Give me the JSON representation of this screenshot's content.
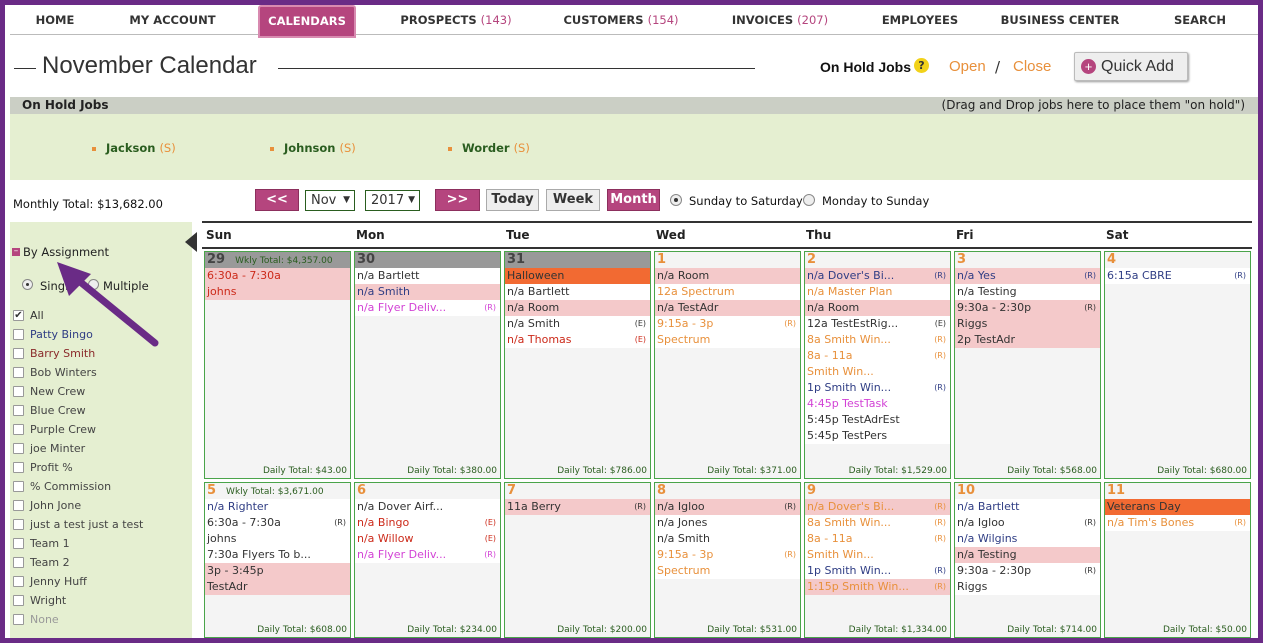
{
  "nav": {
    "items": [
      {
        "label": "HOME",
        "count": ""
      },
      {
        "label": "MY ACCOUNT",
        "count": ""
      },
      {
        "label": "CALENDARS",
        "count": ""
      },
      {
        "label": "PROSPECTS",
        "count": "(143)"
      },
      {
        "label": "CUSTOMERS",
        "count": "(154)"
      },
      {
        "label": "INVOICES",
        "count": "(207)"
      },
      {
        "label": "EMPLOYEES",
        "count": ""
      },
      {
        "label": "BUSINESS CENTER",
        "count": ""
      },
      {
        "label": "SEARCH",
        "count": ""
      }
    ],
    "active": "CALENDARS"
  },
  "header": {
    "title": "November Calendar",
    "on_hold_label": "On Hold Jobs",
    "help_icon": "?",
    "open_link": "Open",
    "separator": "/",
    "close_link": "Close",
    "quick_add": "Quick Add",
    "quick_add_icon": "+"
  },
  "on_hold": {
    "bar_label": "On Hold Jobs",
    "hint": "(Drag and Drop jobs here to place them \"on hold\")",
    "jobs": [
      {
        "name": "Jackson",
        "badge": "(S)"
      },
      {
        "name": "Johnson",
        "badge": "(S)"
      },
      {
        "name": "Worder",
        "badge": "(S)"
      }
    ]
  },
  "controls": {
    "monthly_total": "Monthly Total: $13,682.00",
    "prev": "<<",
    "month_value": "Nov",
    "year_value": "2017",
    "next": ">>",
    "today": "Today",
    "week": "Week",
    "month": "Month",
    "radio_sun": "Sunday to Saturday",
    "radio_mon": "Monday to Sunday",
    "radio_selected": "Sunday to Saturday",
    "select_arrow": "▼"
  },
  "sidebar": {
    "collapse_icon": "–",
    "title": "By Assignment",
    "mode_single": "Single",
    "mode_multiple": "Multiple",
    "mode_selected": "Single",
    "items": [
      {
        "label": "All",
        "checked": true,
        "color": "#333333"
      },
      {
        "label": "Patty Bingo",
        "checked": false,
        "color": "#2f3d84"
      },
      {
        "label": "Barry Smith",
        "checked": false,
        "color": "#8a2a2a"
      },
      {
        "label": "Bob Winters",
        "checked": false,
        "color": "#444444"
      },
      {
        "label": "New Crew",
        "checked": false,
        "color": "#444444"
      },
      {
        "label": "Blue Crew",
        "checked": false,
        "color": "#444444"
      },
      {
        "label": "Purple Crew",
        "checked": false,
        "color": "#444444"
      },
      {
        "label": "joe Minter",
        "checked": false,
        "color": "#444444"
      },
      {
        "label": "Profit %",
        "checked": false,
        "color": "#444444"
      },
      {
        "label": "% Commission",
        "checked": false,
        "color": "#444444"
      },
      {
        "label": "John Jone",
        "checked": false,
        "color": "#444444"
      },
      {
        "label": "just a test just a test",
        "checked": false,
        "color": "#444444"
      },
      {
        "label": "Team 1",
        "checked": false,
        "color": "#444444"
      },
      {
        "label": "Team 2",
        "checked": false,
        "color": "#444444"
      },
      {
        "label": "Jenny Huff",
        "checked": false,
        "color": "#444444"
      },
      {
        "label": "Wright",
        "checked": false,
        "color": "#444444"
      },
      {
        "label": "None",
        "checked": false,
        "color": "#999999"
      }
    ],
    "check_mark": "✔"
  },
  "calendar": {
    "days": [
      "Sun",
      "Mon",
      "Tue",
      "Wed",
      "Thu",
      "Fri",
      "Sat"
    ],
    "weeks": [
      {
        "weekly_total": "Wkly Total: $4,357.00",
        "cells": [
          {
            "date": "29",
            "prev": true,
            "total": "Daily Total: $43.00",
            "events": [
              {
                "text": "6:30a - 7:30a",
                "color": "c-red",
                "bg": "pink",
                "tag": ""
              },
              {
                "text": "johns",
                "color": "c-red",
                "bg": "pink",
                "tag": ""
              }
            ]
          },
          {
            "date": "30",
            "prev": true,
            "total": "Daily Total: $380.00",
            "events": [
              {
                "text": "n/a Bartlett",
                "color": "c-dark",
                "bg": "white",
                "tag": ""
              },
              {
                "text": "n/a Smith",
                "color": "c-navy",
                "bg": "pink",
                "tag": ""
              },
              {
                "text": "n/a Flyer Deliv...",
                "color": "c-purple",
                "bg": "white",
                "tag": "(R)"
              }
            ]
          },
          {
            "date": "31",
            "prev": true,
            "total": "Daily Total: $786.00",
            "events": [
              {
                "text": "Halloween",
                "color": "c-dark",
                "bg": "orange",
                "tag": ""
              },
              {
                "text": "n/a Bartlett",
                "color": "c-dark",
                "bg": "white",
                "tag": ""
              },
              {
                "text": "n/a Room",
                "color": "c-dark",
                "bg": "pink",
                "tag": ""
              },
              {
                "text": "n/a Smith",
                "color": "c-dark",
                "bg": "white",
                "tag": "(E)"
              },
              {
                "text": "n/a Thomas",
                "color": "c-red",
                "bg": "white",
                "tag": "(E)"
              }
            ]
          },
          {
            "date": "1",
            "prev": false,
            "total": "Daily Total: $371.00",
            "events": [
              {
                "text": "n/a  Room",
                "color": "c-dark",
                "bg": "pink",
                "tag": ""
              },
              {
                "text": "12a Spectrum",
                "color": "c-orange",
                "bg": "white",
                "tag": ""
              },
              {
                "text": "n/a  TestAdr",
                "color": "c-dark",
                "bg": "pink",
                "tag": ""
              },
              {
                "text": "9:15a - 3p",
                "color": "c-orange",
                "bg": "white",
                "tag": "(R)"
              },
              {
                "text": "Spectrum",
                "color": "c-orange",
                "bg": "white",
                "tag": ""
              }
            ]
          },
          {
            "date": "2",
            "prev": false,
            "total": "Daily Total: $1,529.00",
            "events": [
              {
                "text": "n/a     Dover's Bi...",
                "color": "c-navy",
                "bg": "pink",
                "tag": "(R)"
              },
              {
                "text": "n/a     Master Plan",
                "color": "c-orange",
                "bg": "white",
                "tag": ""
              },
              {
                "text": "n/a     Room",
                "color": "c-dark",
                "bg": "pink",
                "tag": ""
              },
              {
                "text": "12a     TestEstRig...",
                "color": "c-dark",
                "bg": "white",
                "tag": "(E)"
              },
              {
                "text": "8a      Smith Win...",
                "color": "c-orange",
                "bg": "white",
                "tag": "(R)"
              },
              {
                "text": "8a - 11a",
                "color": "c-orange",
                "bg": "white",
                "tag": "(R)"
              },
              {
                "text": "Smith Win...",
                "color": "c-orange",
                "bg": "white",
                "tag": ""
              },
              {
                "text": "1p      Smith Win...",
                "color": "c-navy",
                "bg": "white",
                "tag": "(R)"
              },
              {
                "text": "4:45p TestTask",
                "color": "c-purple",
                "bg": "white",
                "tag": ""
              },
              {
                "text": "5:45p TestAdrEst",
                "color": "c-dark",
                "bg": "white",
                "tag": ""
              },
              {
                "text": "5:45p TestPers",
                "color": "c-dark",
                "bg": "white",
                "tag": ""
              }
            ]
          },
          {
            "date": "3",
            "prev": false,
            "total": "Daily Total: $568.00",
            "events": [
              {
                "text": "n/a Yes",
                "color": "c-navy",
                "bg": "pink",
                "tag": "(R)"
              },
              {
                "text": "n/a Testing",
                "color": "c-dark",
                "bg": "white",
                "tag": ""
              },
              {
                "text": "9:30a - 2:30p",
                "color": "c-dark",
                "bg": "pink",
                "tag": "(R)"
              },
              {
                "text": "Riggs",
                "color": "c-dark",
                "bg": "pink",
                "tag": ""
              },
              {
                "text": "2p  TestAdr",
                "color": "c-dark",
                "bg": "pink",
                "tag": ""
              }
            ]
          },
          {
            "date": "4",
            "prev": false,
            "total": "Daily Total: $680.00",
            "events": [
              {
                "text": "6:15a CBRE",
                "color": "c-navy",
                "bg": "white",
                "tag": "(R)"
              }
            ]
          }
        ]
      },
      {
        "weekly_total": "Wkly Total: $3,671.00",
        "cells": [
          {
            "date": "5",
            "prev": false,
            "total": "Daily Total: $608.00",
            "events": [
              {
                "text": "n/a     Righter",
                "color": "c-navy",
                "bg": "white",
                "tag": ""
              },
              {
                "text": "6:30a - 7:30a",
                "color": "c-dark",
                "bg": "white",
                "tag": "(R)"
              },
              {
                "text": "johns",
                "color": "c-dark",
                "bg": "white",
                "tag": ""
              },
              {
                "text": "7:30a Flyers To b...",
                "color": "c-dark",
                "bg": "white",
                "tag": ""
              },
              {
                "text": "3p - 3:45p",
                "color": "c-dark",
                "bg": "pink",
                "tag": ""
              },
              {
                "text": "TestAdr",
                "color": "c-dark",
                "bg": "pink",
                "tag": ""
              }
            ]
          },
          {
            "date": "6",
            "prev": false,
            "total": "Daily Total: $234.00",
            "events": [
              {
                "text": "n/a Dover Airf...",
                "color": "c-dark",
                "bg": "white",
                "tag": ""
              },
              {
                "text": "n/a Bingo",
                "color": "c-red",
                "bg": "white",
                "tag": "(E)"
              },
              {
                "text": "n/a Willow",
                "color": "c-red",
                "bg": "white",
                "tag": "(E)"
              },
              {
                "text": "n/a Flyer Deliv...",
                "color": "c-purple",
                "bg": "white",
                "tag": "(R)"
              }
            ]
          },
          {
            "date": "7",
            "prev": false,
            "total": "Daily Total: $200.00",
            "events": [
              {
                "text": "11a Berry",
                "color": "c-dark",
                "bg": "pink",
                "tag": "(R)"
              }
            ]
          },
          {
            "date": "8",
            "prev": false,
            "total": "Daily Total: $531.00",
            "events": [
              {
                "text": "n/a Igloo",
                "color": "c-dark",
                "bg": "pink",
                "tag": "(R)"
              },
              {
                "text": "n/a Jones",
                "color": "c-dark",
                "bg": "white",
                "tag": ""
              },
              {
                "text": "n/a Smith",
                "color": "c-dark",
                "bg": "white",
                "tag": ""
              },
              {
                "text": "9:15a - 3p",
                "color": "c-orange",
                "bg": "white",
                "tag": "(R)"
              },
              {
                "text": "Spectrum",
                "color": "c-orange",
                "bg": "white",
                "tag": ""
              }
            ]
          },
          {
            "date": "9",
            "prev": false,
            "total": "Daily Total: $1,334.00",
            "events": [
              {
                "text": "n/a     Dover's Bi...",
                "color": "c-orange",
                "bg": "pink",
                "tag": "(R)"
              },
              {
                "text": "8a      Smith Win...",
                "color": "c-orange",
                "bg": "white",
                "tag": "(R)"
              },
              {
                "text": "8a - 11a",
                "color": "c-orange",
                "bg": "white",
                "tag": "(R)"
              },
              {
                "text": "Smith Win...",
                "color": "c-orange",
                "bg": "white",
                "tag": ""
              },
              {
                "text": "1p      Smith Win...",
                "color": "c-navy",
                "bg": "white",
                "tag": "(R)"
              },
              {
                "text": "1:15p Smith Win...",
                "color": "c-orange",
                "bg": "pink",
                "tag": "(R)"
              }
            ]
          },
          {
            "date": "10",
            "prev": false,
            "total": "Daily Total: $714.00",
            "events": [
              {
                "text": "n/a Bartlett",
                "color": "c-navy",
                "bg": "white",
                "tag": ""
              },
              {
                "text": "n/a Igloo",
                "color": "c-dark",
                "bg": "white",
                "tag": "(R)"
              },
              {
                "text": "n/a Wilgins",
                "color": "c-navy",
                "bg": "white",
                "tag": ""
              },
              {
                "text": "n/a Testing",
                "color": "c-dark",
                "bg": "pink",
                "tag": ""
              },
              {
                "text": "9:30a - 2:30p",
                "color": "c-dark",
                "bg": "white",
                "tag": "(R)"
              },
              {
                "text": "Riggs",
                "color": "c-dark",
                "bg": "white",
                "tag": ""
              }
            ]
          },
          {
            "date": "11",
            "prev": false,
            "total": "Daily Total: $50.00",
            "events": [
              {
                "text": "Veterans Day",
                "color": "c-dark",
                "bg": "orange",
                "tag": ""
              },
              {
                "text": "n/a Tim's Bones",
                "color": "c-orange",
                "bg": "white",
                "tag": "(R)"
              }
            ]
          }
        ]
      }
    ]
  }
}
